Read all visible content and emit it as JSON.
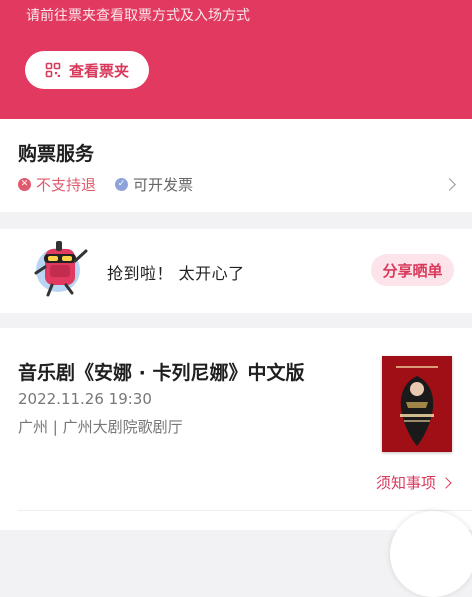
{
  "header": {
    "hint": "请前往票夹查看取票方式及入场方式",
    "ticket_button": {
      "label": "查看票夹",
      "icon": "ticket-wallet-icon"
    }
  },
  "service": {
    "title": "购票服务",
    "tags": [
      {
        "label": "不支持退",
        "icon": "cross-circle-icon",
        "color": "#e05a6d"
      },
      {
        "label": "可开发票",
        "icon": "check-circle-icon",
        "color": "#8ea3d9"
      }
    ]
  },
  "share": {
    "text": "抢到啦！ 太开心了",
    "button": "分享晒单",
    "avatar_icon": "mascot-icon"
  },
  "show": {
    "title": "音乐剧《安娜 · 卡列尼娜》中文版",
    "datetime": "2022.11.26 19:30",
    "venue": "广州 | 广州大剧院歌剧厅",
    "notice": "须知事项"
  },
  "colors": {
    "brand": "#e1395f",
    "accent_text": "#d93a5c",
    "share_bg": "#fde3ea"
  }
}
